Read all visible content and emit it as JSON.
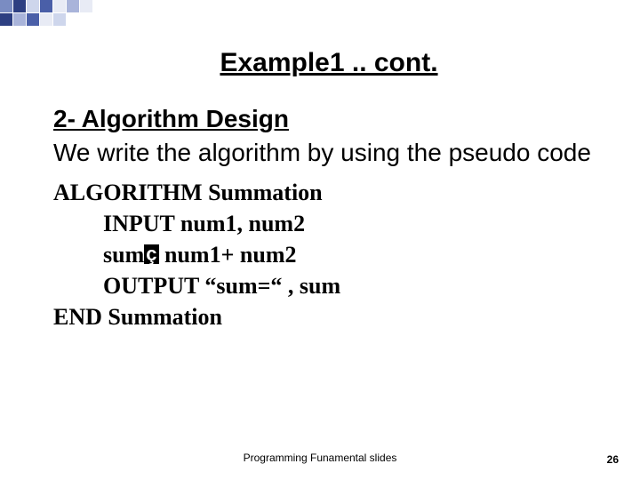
{
  "slide": {
    "title": "Example1 .. cont.",
    "subhead": "2- Algorithm Design",
    "intro": "We write the algorithm by using the pseudo code",
    "pseudo": {
      "l1": "ALGORITHM Summation",
      "l2": "INPUT num1, num2",
      "l3a": "sum",
      "l3b": " num1+ num2",
      "l4": "OUTPUT  “sum=“ , sum",
      "l5": "END Summation"
    },
    "arrow": "ç",
    "footer": "Programming Funamental slides",
    "page": "26"
  },
  "deco_colors": {
    "d1": "#2d3f82",
    "d2": "#4a5fa8",
    "d3": "#7a8cc2",
    "d4": "#a9b4da",
    "d5": "#ced6ec",
    "d6": "#e8ebf5"
  }
}
